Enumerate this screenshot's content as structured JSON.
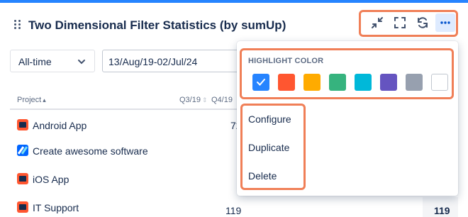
{
  "gadget": {
    "title": "Two Dimensional Filter Statistics (by sumUp)",
    "toolbar": [
      {
        "name": "minimize-icon"
      },
      {
        "name": "fullscreen-icon"
      },
      {
        "name": "refresh-icon"
      },
      {
        "name": "more-icon"
      }
    ]
  },
  "filters": {
    "time_range": "All-time",
    "date_range": "13/Aug/19-02/Jul/24"
  },
  "table": {
    "headers": [
      "Project",
      "Q3/19",
      "Q4/19"
    ],
    "rows": [
      {
        "project": "Android App",
        "icon_color": "#ff5630",
        "q4": "72"
      },
      {
        "project": "Create awesome software",
        "icon_color": "#0065ff",
        "q4": ""
      },
      {
        "project": "iOS App",
        "icon_color": "#ff5630",
        "q4": ""
      },
      {
        "project": "IT Support",
        "icon_color": "#ff5630",
        "q4": "119"
      }
    ],
    "total": "119"
  },
  "menu": {
    "highlight_title": "HIGHLIGHT COLOR",
    "colors": [
      "#2684ff",
      "#ff5630",
      "#ffab00",
      "#36b37e",
      "#00b8d9",
      "#6554c0",
      "#97a0af",
      "#ffffff"
    ],
    "selected_color": "#2684ff",
    "items": [
      "Configure",
      "Duplicate",
      "Delete"
    ]
  },
  "accent": "#f07f57"
}
